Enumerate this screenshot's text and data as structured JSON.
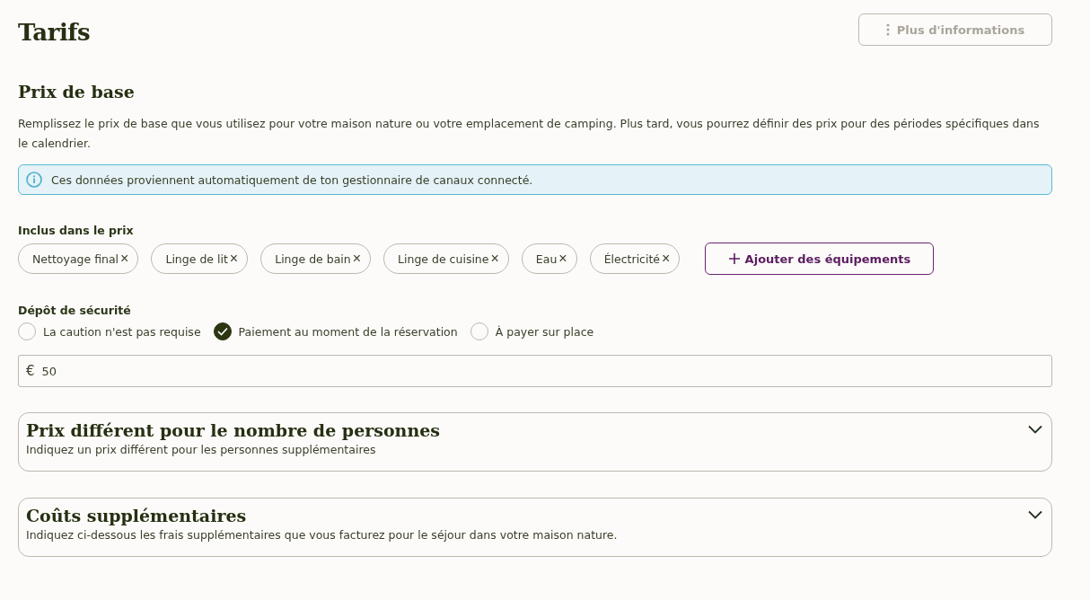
{
  "page": {
    "title": "Tarifs",
    "more_button": "Plus d'informations"
  },
  "base_price": {
    "title": "Prix de base",
    "description": "Remplissez le prix de base que vous utilisez pour votre maison nature ou votre emplacement de camping. Plus tard, vous pourrez définir des prix pour des périodes spécifiques dans le calendrier.",
    "info": "Ces données proviennent automatiquement de ton gestionnaire de canaux connecté."
  },
  "included": {
    "label": "Inclus dans le prix",
    "chips": [
      {
        "label": "Nettoyage final",
        "remove": "×"
      },
      {
        "label": "Linge de lit",
        "remove": "×"
      },
      {
        "label": "Linge de bain",
        "remove": "×"
      },
      {
        "label": "Linge de cuisine",
        "remove": "×"
      },
      {
        "label": "Eau",
        "remove": "×"
      },
      {
        "label": "Électricité",
        "remove": "×"
      }
    ],
    "add_button": "Ajouter des équipements"
  },
  "deposit": {
    "label": "Dépôt de sécurité",
    "options": [
      {
        "label": "La caution n'est pas requise",
        "selected": false
      },
      {
        "label": "Paiement au moment de la réservation",
        "selected": true
      },
      {
        "label": "À payer sur place",
        "selected": false
      }
    ],
    "currency": "€",
    "amount": "50"
  },
  "sections": [
    {
      "title": "Prix différent pour le nombre de personnes",
      "subtitle": "Indiquez un prix différent pour les personnes supplémentaires",
      "expanded": false
    },
    {
      "title": "Coûts supplémentaires",
      "subtitle": "Indiquez ci-dessous les frais supplémentaires que vous facturez pour le séjour dans votre maison nature.",
      "expanded": false
    }
  ]
}
